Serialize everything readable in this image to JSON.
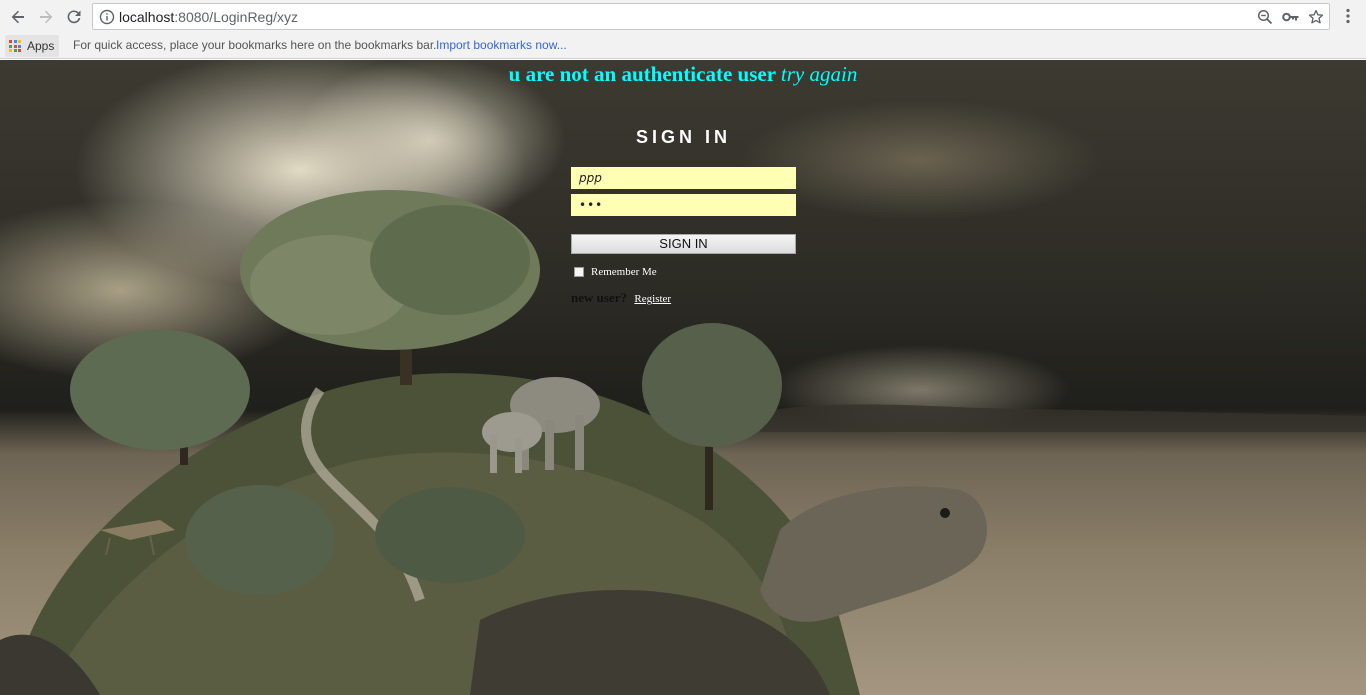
{
  "browser": {
    "url_host": "localhost",
    "url_rest": ":8080/LoginReg/xyz",
    "bookmarks_bar": {
      "apps_label": "Apps",
      "hint": "For quick access, place your bookmarks here on the bookmarks bar.",
      "import_link": "Import bookmarks now..."
    },
    "icons": [
      "back-icon",
      "forward-icon",
      "reload-icon",
      "info-icon",
      "zoom-icon",
      "key-icon",
      "star-icon",
      "menu-icon",
      "apps-grid-icon"
    ]
  },
  "page": {
    "error_message": "u are not an authenticate user",
    "error_retry": "try again",
    "title": "SIGN IN",
    "username_value": "ppp",
    "password_value": "•••",
    "signin_button": "SIGN IN",
    "remember_label": "Remember Me",
    "remember_checked": false,
    "new_user_label": "new user?",
    "register_link": "Register",
    "colors": {
      "error_text": "#00ffff",
      "field_bg": "#ffffb3",
      "title_text": "#ffffff"
    }
  }
}
